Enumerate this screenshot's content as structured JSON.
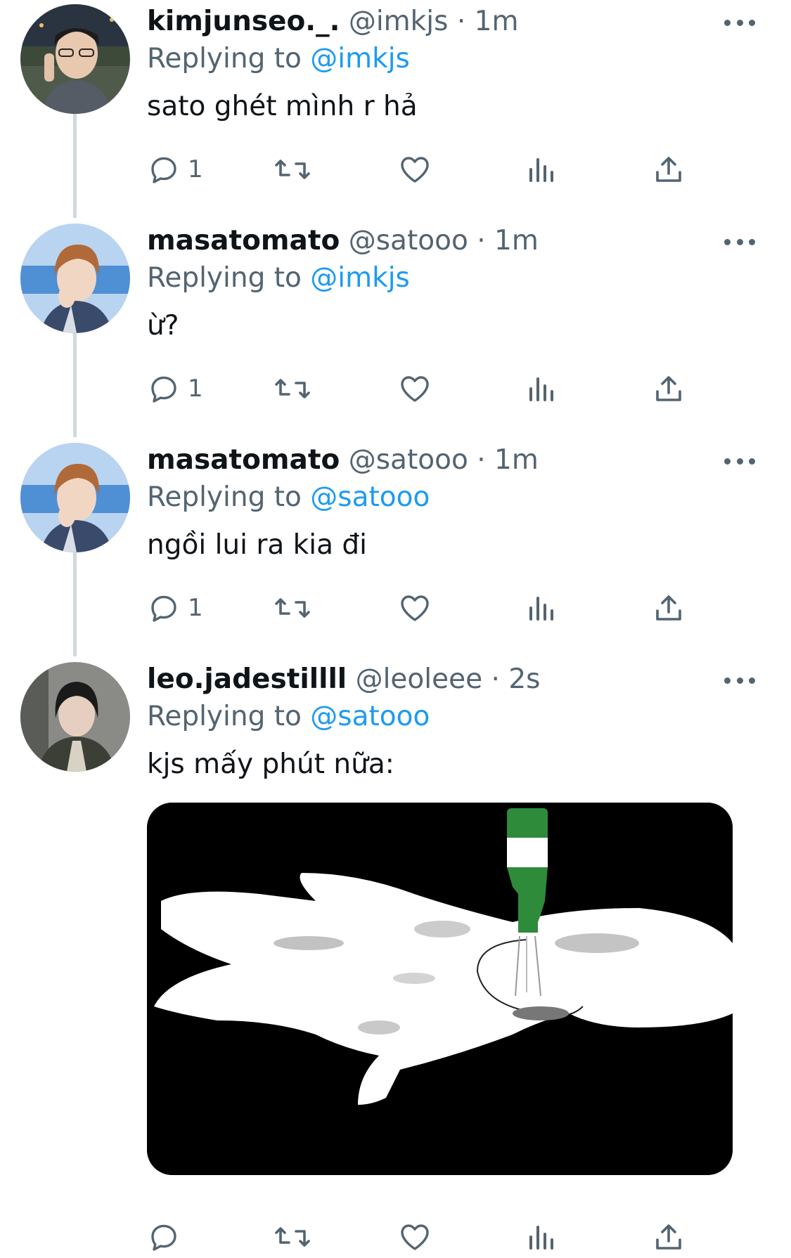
{
  "tweets": [
    {
      "display_name": "kimjunseo._.",
      "handle": "@imkjs",
      "dot": "·",
      "time": "1m",
      "replying_prefix": "Replying to",
      "replying_to": "@imkjs",
      "text": "sato ghét mình r hả",
      "reply_count": "1"
    },
    {
      "display_name": "masatomato",
      "handle": "@satooo",
      "dot": "·",
      "time": "1m",
      "replying_prefix": "Replying to",
      "replying_to": "@imkjs",
      "text": "ừ?",
      "reply_count": "1"
    },
    {
      "display_name": "masatomato",
      "handle": "@satooo",
      "dot": "·",
      "time": "1m",
      "replying_prefix": "Replying to",
      "replying_to": "@satooo",
      "text": "ngồi lui ra kia đi",
      "reply_count": "1"
    },
    {
      "display_name": "leo.jadestillll",
      "handle": "@leoleee",
      "dot": "·",
      "time": "2s",
      "replying_prefix": "Replying to",
      "replying_to": "@satooo",
      "text": "kjs mấy phút nữa:",
      "reply_count": ""
    }
  ],
  "icons": {
    "reply": "reply-icon",
    "retweet": "retweet-icon",
    "like": "heart-icon",
    "views": "views-icon",
    "share": "share-icon",
    "more": "more-icon"
  },
  "colors": {
    "link": "#1d9bf0",
    "secondary_text": "#536471",
    "thread_line": "#cfd9de"
  }
}
